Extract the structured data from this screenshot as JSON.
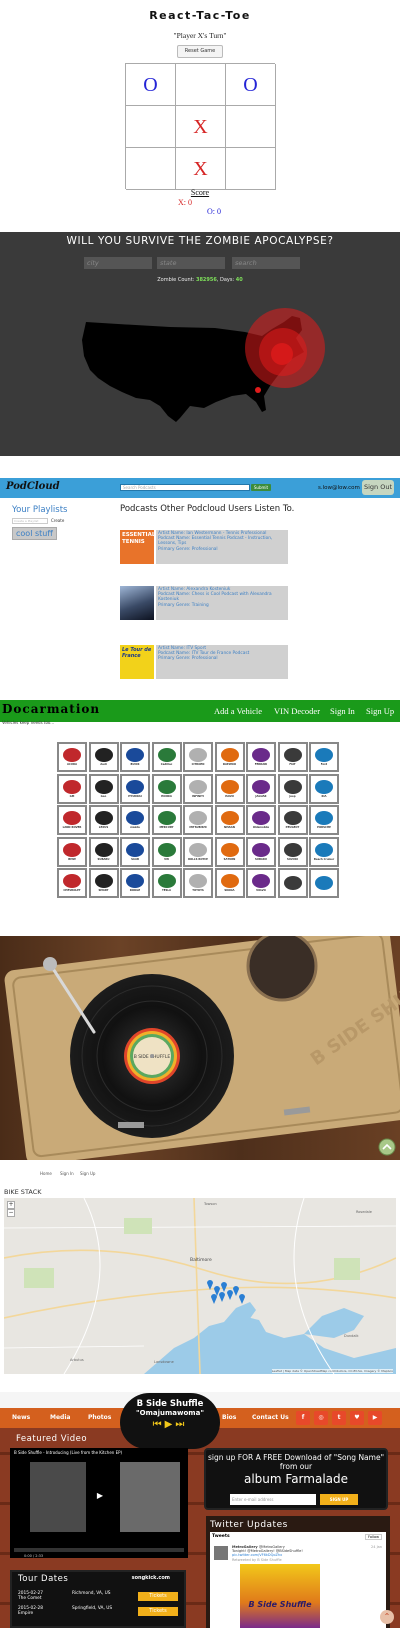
{
  "tictactoe": {
    "title": "React-Tac-Toe",
    "turn": "\"Player X's Turn\"",
    "reset_label": "Reset Game",
    "board": [
      "O",
      "",
      "O",
      "",
      "X",
      "",
      "",
      "X",
      ""
    ],
    "score_label": "Score",
    "score_x": "X: 0",
    "score_o": "O: 0"
  },
  "zombie": {
    "title": "WILL YOU SURVIVE THE ZOMBIE APOCALYPSE?",
    "city_placeholder": "city",
    "state_placeholder": "state",
    "search_placeholder": "search",
    "count_label": "Zombie Count:",
    "count_value": "382956",
    "days_label": ", Days:",
    "days_value": "40",
    "colors": {
      "background": "#3a3a3a",
      "map": "#000000",
      "outbreak": "#e01b1b",
      "count": "#7ee05a"
    }
  },
  "podcloud": {
    "logo": "PodCloud",
    "search_placeholder": "Search Podcasts",
    "submit_label": "Submit",
    "email": "s.low@low.com",
    "signout_label": "Sign Out",
    "playlists_title": "Your Playlists",
    "playlist_placeholder": "Create a Playlist",
    "create_label": "Create",
    "playlists": [
      "cool stuff"
    ],
    "others_title": "Podcasts Other Podcloud Users Listen To.",
    "podcasts": [
      {
        "artist": "Artist Name: Ian Westermann - Tennis Professional",
        "podcast": "Podcast Name: Essential Tennis Podcast - Instruction, Lessons, Tips",
        "genre": "Primary Genre: Professional",
        "thumb_text": "ESSENTIAL TENNIS"
      },
      {
        "artist": "Artist Name: Alexandra Kosteniuk",
        "podcast": "Podcast Name: Chess is Cool Podcast with Alexandra Kosteniuk",
        "genre": "Primary Genre: Training",
        "thumb_text": ""
      },
      {
        "artist": "Artist Name: ITV Sport",
        "podcast": "Podcast Name: ITV Tour de France Podcast",
        "genre": "Primary Genre: Professional",
        "thumb_text": "Le Tour de France"
      }
    ]
  },
  "docarmation": {
    "brand": "Docarmation",
    "tagline": "Vehicles keep needs too...",
    "nav": [
      "Add a Vehicle",
      "VIN Decoder",
      "Sign In",
      "Sign Up"
    ],
    "makes": [
      [
        "ACURA",
        "Audi",
        "BUICK",
        "Cadillac",
        "CITROEN",
        "DAEWOO",
        "FERRARI",
        "FIAT",
        "Ford"
      ],
      [
        "GM",
        "Geo",
        "HYUNDAI",
        "HONDA",
        "INFINITI",
        "ISUZU",
        "JAGUAR",
        "Jeep",
        "KIA"
      ],
      [
        "LAND ROVER",
        "LEXUS",
        "mazda",
        "MERCURY",
        "MITSUBISHI",
        "NISSAN",
        "Oldsmobile",
        "PEUGEOT",
        "PORSCHE"
      ],
      [
        "BMW",
        "SUBARU",
        "SAAB",
        "VW",
        "ROLLS ROYCE",
        "SATURN",
        "SUBARU",
        "SUZUKI",
        "Beach Cruiser"
      ],
      [
        "CHEVROLET",
        "SMART",
        "DODGE",
        "TESLA",
        "TOYOTA",
        "SKODA",
        "VOLVO",
        "",
        ""
      ]
    ]
  },
  "record": {
    "label_text": "B SIDE SHUFFLE",
    "deck_text": "B SIDE SHUFFLE"
  },
  "bikestack": {
    "nav": [
      "Home",
      "Sign In",
      "Sign Up"
    ],
    "title": "BIKE STACK",
    "zoom_in": "+",
    "zoom_out": "−",
    "city_label": "Baltimore",
    "place_labels": [
      "Rosedale",
      "Arbutus",
      "Dundalk",
      "Lansdowne",
      "Towson"
    ],
    "attribution": "Leaflet | Map data © OpenStreetMap contributors, CC-BY-SA, Imagery © Mapbox"
  },
  "bandsite": {
    "nav_left": [
      "News",
      "Media",
      "Photos"
    ],
    "nav_right": [
      "Bios",
      "Contact Us"
    ],
    "band_name": "B Side Shuffle",
    "song": "\"Omajumawoma\"",
    "social": [
      "f",
      "◎",
      "t",
      "♥",
      "▶"
    ],
    "featured_title": "Featured Video",
    "video_title": "B Side Shuffle - Introducing (Live from the Kitchen EP)",
    "video_time": "0:00 / 2:33",
    "signup_title": "sign up FOR A FREE Download of \"Song Name\" from our",
    "album_title": "album Farmalade",
    "email_placeholder": "Enter e-mail address",
    "signup_button": "SIGN UP",
    "tour_title": "Tour Dates",
    "tour_powered": "songkick.com",
    "tour": [
      {
        "date": "2015-02-27",
        "venue": "The Comet",
        "city": "Richmond, VA, US",
        "button": "Tickets"
      },
      {
        "date": "2015-02-28",
        "venue": "Empire",
        "city": "Springfield, VA, US",
        "button": "Tickets"
      }
    ],
    "twitter_title": "Twitter Updates",
    "tweets_label": "Tweets",
    "follow_label": "Follow",
    "tweet_author": "MetroGallery",
    "tweet_handle": "@MetroGallery",
    "tweet_text": "Tonight! @MetroGallery! @BSideShuffle!",
    "tweet_link": "pic.twitter.com/VF6kDQoZhx",
    "tweet_retweeted": "Retweeted by B Side Shuffle",
    "tweet_time": "24 Jan",
    "poster_text": "B Side Shuffle"
  }
}
